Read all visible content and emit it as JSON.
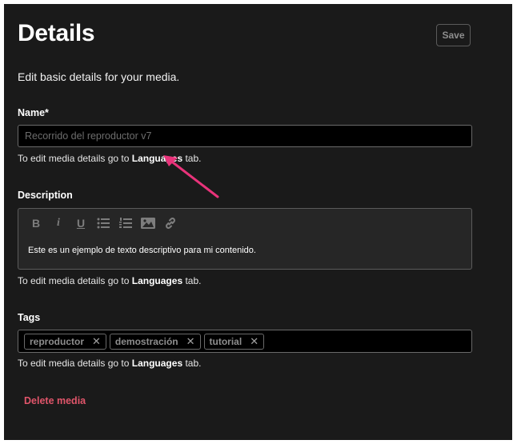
{
  "header": {
    "title": "Details",
    "save_label": "Save"
  },
  "subtitle": "Edit basic details for your media.",
  "name_field": {
    "label": "Name",
    "required_mark": "*",
    "value": "Recorrido del reproductor v7"
  },
  "hint": {
    "prefix": "To edit media details go to ",
    "link": "Languages",
    "suffix": " tab."
  },
  "description_field": {
    "label": "Description",
    "toolbar": {
      "bold": "B",
      "italic": "i",
      "underline": "U"
    },
    "text": "Este es un ejemplo de texto descriptivo para mi contenido."
  },
  "tags_field": {
    "label": "Tags",
    "tags": [
      "reproductor",
      "demostración",
      "tutorial"
    ],
    "remove_glyph": "✕"
  },
  "delete_label": "Delete media",
  "colors": {
    "background": "#1a1a1a",
    "danger": "#e0556a",
    "annotation_arrow": "#e8337a"
  },
  "icons": [
    "bullet-list-icon",
    "numbered-list-icon",
    "image-icon",
    "link-icon",
    "annotation-arrow"
  ]
}
